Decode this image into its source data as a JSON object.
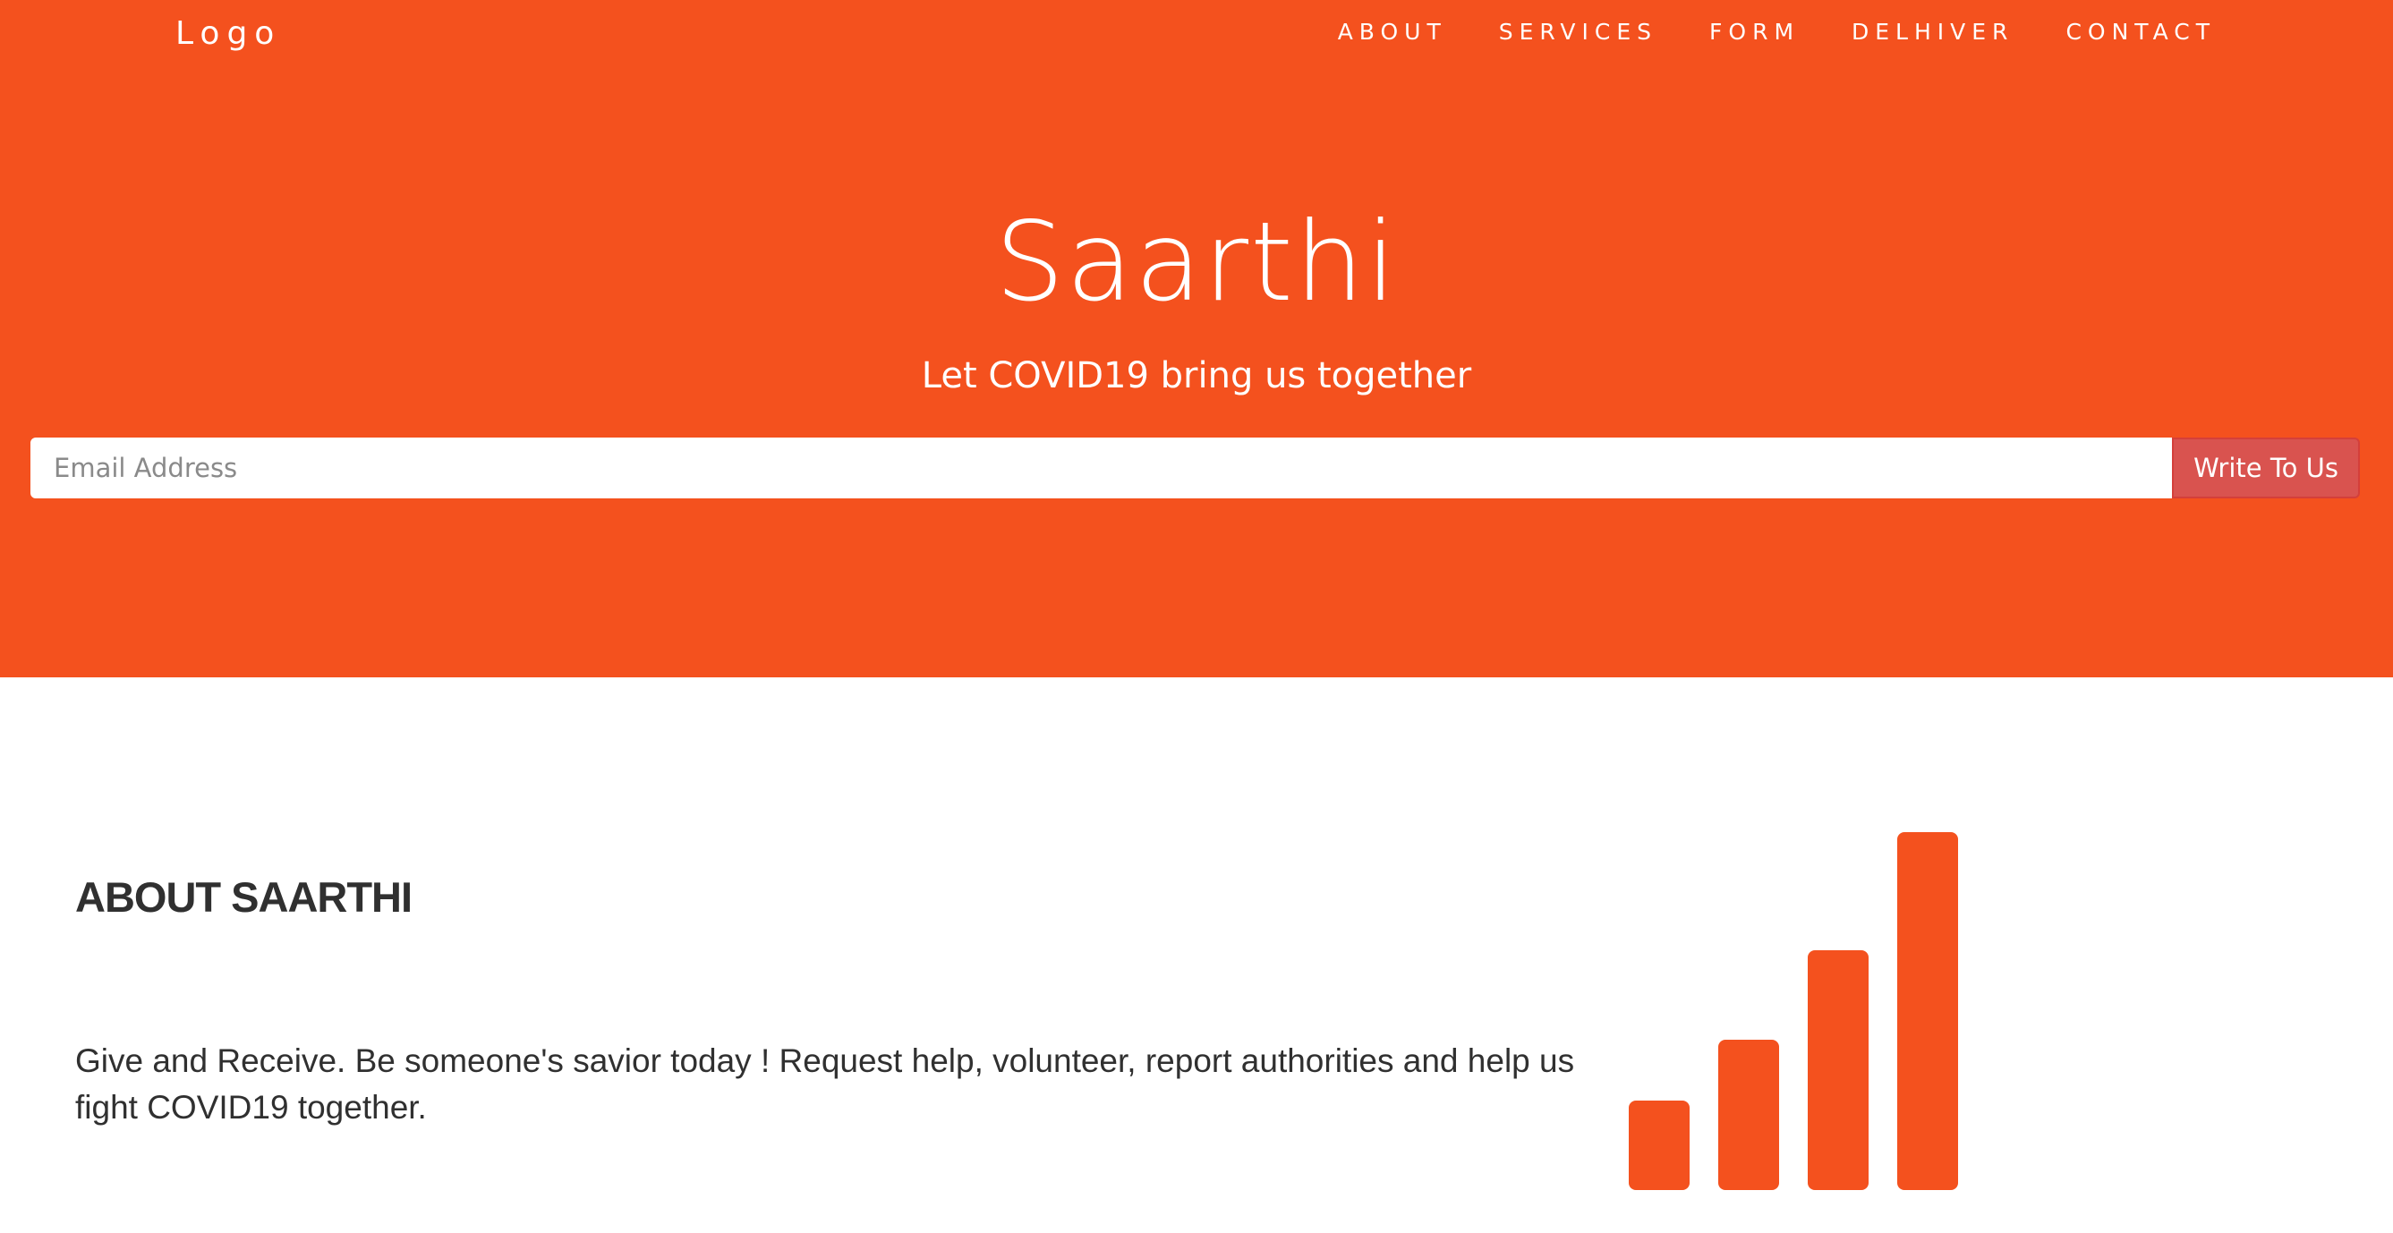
{
  "navbar": {
    "logo": "Logo",
    "items": [
      "ABOUT",
      "SERVICES",
      "FORM",
      "DELHIVER",
      "CONTACT"
    ]
  },
  "hero": {
    "title": "Saarthi",
    "subtitle": "Let COVID19 bring us together",
    "email_placeholder": "Email Address",
    "email_value": "",
    "button_label": "Write To Us"
  },
  "about": {
    "heading": "ABOUT SAARTHI",
    "text": "Give and Receive. Be someone's savior today ! Request help, volunteer, report authorities and help us fight COVID19 together."
  },
  "icon": {
    "name": "signal-bars-icon",
    "bar_levels": [
      0.25,
      0.42,
      0.67,
      1.0
    ]
  },
  "colors": {
    "accent": "#f4511e",
    "button": "#d9534f",
    "text": "#303030",
    "background": "#ffffff"
  }
}
